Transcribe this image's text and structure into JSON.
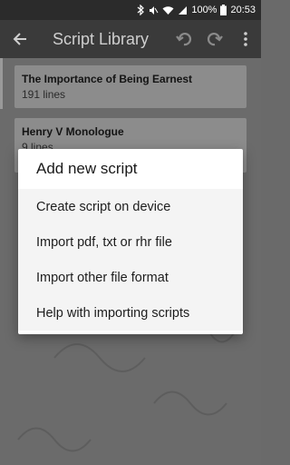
{
  "status_bar": {
    "battery_percent": "100%",
    "time": "20:53"
  },
  "toolbar": {
    "title": "Script Library"
  },
  "scripts": [
    {
      "title": "The Importance of Being Earnest",
      "subtitle": "191 lines"
    },
    {
      "title": "Henry V Monologue",
      "subtitle": "9 lines"
    }
  ],
  "dialog": {
    "title": "Add new script",
    "items": [
      "Create script on device",
      "Import pdf, txt or rhr file",
      "Import other file format",
      "Help with importing scripts"
    ]
  },
  "colors": {
    "toolbar": "#3a3a3a",
    "status_bar": "#2b2b2b",
    "background": "#6b6b6b",
    "dialog": "#ffffff"
  },
  "icons": [
    "bluetooth-icon",
    "mute-icon",
    "wifi-icon",
    "signal-icon",
    "battery-icon",
    "back-arrow-icon",
    "undo-icon",
    "redo-icon",
    "overflow-menu-icon"
  ]
}
